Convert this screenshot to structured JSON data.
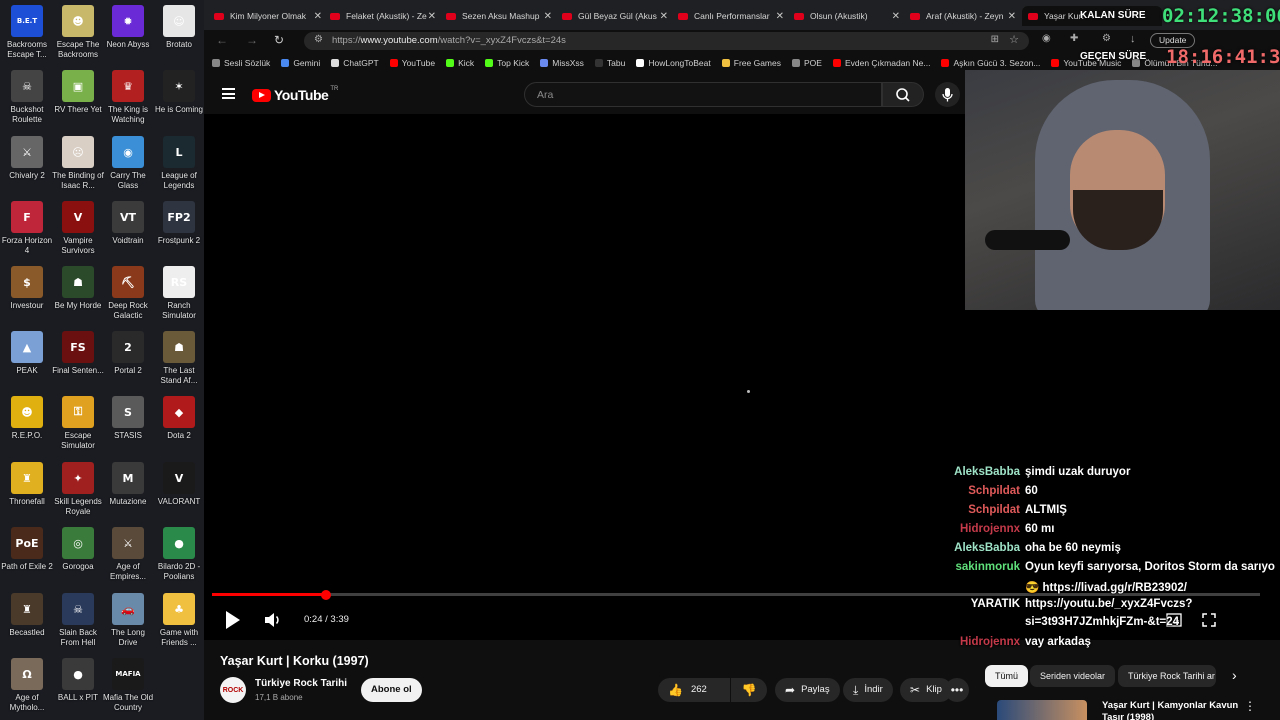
{
  "desktop": {
    "icons": [
      {
        "label": "Backrooms Escape T...",
        "color": "#1d4fd6",
        "glyph": "B.E.T"
      },
      {
        "label": "Escape The Backrooms",
        "color": "#c8b86a",
        "glyph": "☻"
      },
      {
        "label": "Neon Abyss",
        "color": "#6a2ad6",
        "glyph": "✹"
      },
      {
        "label": "Brotato",
        "color": "#e6e6e6",
        "glyph": "☺"
      },
      {
        "label": "Buckshot Roulette",
        "color": "#444",
        "glyph": "☠"
      },
      {
        "label": "RV There Yet",
        "color": "#7ab04a",
        "glyph": "▣"
      },
      {
        "label": "The King is Watching",
        "color": "#b32020",
        "glyph": "♛"
      },
      {
        "label": "He is Coming",
        "color": "#222",
        "glyph": "✶"
      },
      {
        "label": "Chivalry 2",
        "color": "#666",
        "glyph": "⚔"
      },
      {
        "label": "The Binding of Isaac R...",
        "color": "#d9cfc5",
        "glyph": "☹"
      },
      {
        "label": "Carry The Glass",
        "color": "#3a8fd6",
        "glyph": "◉"
      },
      {
        "label": "League of Legends",
        "color": "#1a2a30",
        "glyph": "L"
      },
      {
        "label": "Forza Horizon 4",
        "color": "#c0263a",
        "glyph": "F"
      },
      {
        "label": "Vampire Survivors",
        "color": "#8a1010",
        "glyph": "V"
      },
      {
        "label": "Voidtrain",
        "color": "#3b3b3b",
        "glyph": "VT"
      },
      {
        "label": "Frostpunk 2",
        "color": "#2e3440",
        "glyph": "FP2"
      },
      {
        "label": "Investour",
        "color": "#8a5a2a",
        "glyph": "$"
      },
      {
        "label": "Be My Horde",
        "color": "#2a4a2a",
        "glyph": "☗"
      },
      {
        "label": "Deep Rock Galactic",
        "color": "#8a3a1a",
        "glyph": "⛏"
      },
      {
        "label": "Ranch Simulator",
        "color": "#eeeeee",
        "glyph": "RS"
      },
      {
        "label": "PEAK",
        "color": "#7aa0d6",
        "glyph": "▲"
      },
      {
        "label": "Final Senten...",
        "color": "#6a1010",
        "glyph": "FS"
      },
      {
        "label": "Portal 2",
        "color": "#2a2a2a",
        "glyph": "2"
      },
      {
        "label": "The Last Stand Af...",
        "color": "#6a5a3a",
        "glyph": "☗"
      },
      {
        "label": "R.E.P.O.",
        "color": "#e0b010",
        "glyph": "☻"
      },
      {
        "label": "Escape Simulator",
        "color": "#e0a020",
        "glyph": "⚿"
      },
      {
        "label": "STASIS",
        "color": "#5a5a5a",
        "glyph": "S"
      },
      {
        "label": "Dota 2",
        "color": "#b01a1a",
        "glyph": "◆"
      },
      {
        "label": "Thronefall",
        "color": "#e0b020",
        "glyph": "♜"
      },
      {
        "label": "Skill Legends Royale",
        "color": "#a02020",
        "glyph": "✦"
      },
      {
        "label": "Mutazione",
        "color": "#3a3a3a",
        "glyph": "M"
      },
      {
        "label": "VALORANT",
        "color": "#1a1a1a",
        "glyph": "V"
      },
      {
        "label": "Path of Exile 2",
        "color": "#4a2a1a",
        "glyph": "PoE"
      },
      {
        "label": "Gorogoa",
        "color": "#3a7a3a",
        "glyph": "◎"
      },
      {
        "label": "Age of Empires...",
        "color": "#5a4a3a",
        "glyph": "⚔"
      },
      {
        "label": "Bilardo 2D - Poolians",
        "color": "#2a8a4a",
        "glyph": "●"
      },
      {
        "label": "Becastled",
        "color": "#4a3a2a",
        "glyph": "♜"
      },
      {
        "label": "Slain Back From Hell",
        "color": "#2a3a5a",
        "glyph": "☠"
      },
      {
        "label": "The Long Drive",
        "color": "#6a8aaa",
        "glyph": "🚗"
      },
      {
        "label": "Game with Friends ...",
        "color": "#f0c040",
        "glyph": "♣"
      },
      {
        "label": "Age of Mytholo...",
        "color": "#7a6a5a",
        "glyph": "Ω"
      },
      {
        "label": "BALL x PIT",
        "color": "#3a3a3a",
        "glyph": "●"
      },
      {
        "label": "Mafia The Old Country",
        "color": "#1a1a1a",
        "glyph": "MAFIA"
      }
    ]
  },
  "tabs": [
    {
      "label": "Kim Milyoner Olmak",
      "close": "✕"
    },
    {
      "label": "Felaket (Akustik) - Ze",
      "close": "✕"
    },
    {
      "label": "Sezen Aksu Mashup",
      "close": "✕"
    },
    {
      "label": "Gül Beyaz Gül (Akus",
      "close": "✕"
    },
    {
      "label": "Canlı Performanslar",
      "close": "✕"
    },
    {
      "label": "Olsun (Akustik)",
      "close": "✕"
    },
    {
      "label": "Araf (Akustik) - Zeyn",
      "close": "✕"
    },
    {
      "label": "Yaşar Kurt",
      "close": "✕"
    }
  ],
  "addressbar": {
    "url_prefix": "https://",
    "url_host": "www.youtube.com",
    "url_path": "/watch?v=_xyxZ4Fvczs&t=24s",
    "update_label": "Update"
  },
  "bookmarks": [
    {
      "label": "Sesli Sözlük",
      "color": "#888"
    },
    {
      "label": "Gemini",
      "color": "#4a8af0"
    },
    {
      "label": "ChatGPT",
      "color": "#ddd"
    },
    {
      "label": "YouTube",
      "color": "#f00"
    },
    {
      "label": "Kick",
      "color": "#53fc18"
    },
    {
      "label": "Top Kick",
      "color": "#53fc18"
    },
    {
      "label": "MissXss",
      "color": "#6a8af0"
    },
    {
      "label": "Tabu",
      "color": "#333"
    },
    {
      "label": "HowLongToBeat",
      "color": "#fff"
    },
    {
      "label": "Free Games",
      "color": "#f0c040"
    },
    {
      "label": "POE",
      "color": "#888"
    },
    {
      "label": "Evden Çıkmadan Ne...",
      "color": "#f00"
    },
    {
      "label": "Aşkın Gücü 3. Sezon...",
      "color": "#f00"
    },
    {
      "label": "YouTube Music",
      "color": "#f00"
    },
    {
      "label": "Ölümün Bin Türlü...",
      "color": "#888"
    }
  ],
  "youtube": {
    "logo_text": "YouTube",
    "country": "TR",
    "search_placeholder": "Ara"
  },
  "player": {
    "progress_fraction": 0.109,
    "current_time": "0:24",
    "duration": "3:39",
    "time_separator": " / "
  },
  "overlay": {
    "remaining_label": "KALAN SÜRE",
    "remaining_time": "02:12:38:06",
    "elapsed_label": "GEÇEN SÜRE",
    "elapsed_time": "18:16:41:37"
  },
  "chat": [
    {
      "user": "AleksBabba",
      "color": "#9fe3c8",
      "msg": "şimdi uzak duruyor"
    },
    {
      "user": "Schpildat",
      "color": "#e05a5a",
      "msg": "60"
    },
    {
      "user": "Schpildat",
      "color": "#e05a5a",
      "msg": "ALTMIŞ"
    },
    {
      "user": "Hidrojennx",
      "color": "#c43a4a",
      "msg": "60 mı"
    },
    {
      "user": "AleksBabba",
      "color": "#9fe3c8",
      "msg": "oha be 60 neymiş"
    },
    {
      "user": "sakinmoruk",
      "color": "#5fe07a",
      "msg": "Oyun keyfi sarıyorsa, Doritos Storm da sarıyo"
    },
    {
      "user": "",
      "color": "#ffffff",
      "msg": "😎 https://livad.gg/r/RB23902/"
    },
    {
      "user": "YARATIK",
      "color": "#ffffff",
      "msg": "https://youtu.be/_xyxZ4Fvczs?"
    },
    {
      "user": "",
      "color": "#ffffff",
      "msg": "si=3t93H7JZmhkjFZm-&t=24"
    },
    {
      "user": "Hidrojennx",
      "color": "#c43a4a",
      "msg": "vay arkadaş"
    }
  ],
  "video": {
    "title": "Yaşar Kurt | Korku (1997)",
    "channel_name": "Türkiye Rock Tarihi",
    "channel_avatar_text": "ROCK",
    "subscribers": "17,1 B abone",
    "subscribe_label": "Abone ol",
    "likes": "262",
    "share_label": "Paylaş",
    "download_label": "İndir",
    "clip_label": "Klip"
  },
  "chips": [
    {
      "label": "Tümü",
      "selected": true
    },
    {
      "label": "Seriden videolar",
      "selected": false
    },
    {
      "label": "Türkiye Rock Tarihi ar",
      "selected": false
    }
  ],
  "recommended": {
    "title": "Yaşar Kurt | Kamyonlar Kavun",
    "subtitle": "Taşır (1998)"
  }
}
